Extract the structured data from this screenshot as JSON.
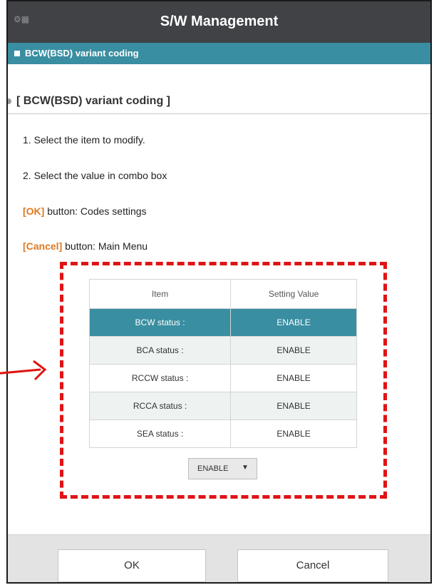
{
  "header": {
    "title": "S/W Management",
    "icon": "settings-icon"
  },
  "breadcrumb": {
    "label": "BCW(BSD) variant coding"
  },
  "section": {
    "title": "[ BCW(BSD) variant coding ]"
  },
  "instructions": {
    "step1": "1. Select the item to modify.",
    "step2": "2. Select the value in combo box",
    "ok_key": "[OK]",
    "ok_desc": " button: Codes settings",
    "cancel_key": "[Cancel]",
    "cancel_desc": " button: Main Menu"
  },
  "table": {
    "headers": [
      "Item",
      "Setting Value"
    ],
    "rows": [
      {
        "item": "BCW status :",
        "value": "ENABLE"
      },
      {
        "item": "BCA status :",
        "value": "ENABLE"
      },
      {
        "item": "RCCW status :",
        "value": "ENABLE"
      },
      {
        "item": "RCCA status :",
        "value": "ENABLE"
      },
      {
        "item": "SEA status :",
        "value": "ENABLE"
      }
    ],
    "selected_row": 0
  },
  "combo": {
    "value": "ENABLE"
  },
  "footer": {
    "ok_label": "OK",
    "cancel_label": "Cancel"
  },
  "colors": {
    "accent": "#3a8ea1",
    "highlight": "#e01414",
    "title_bar": "#404246"
  }
}
